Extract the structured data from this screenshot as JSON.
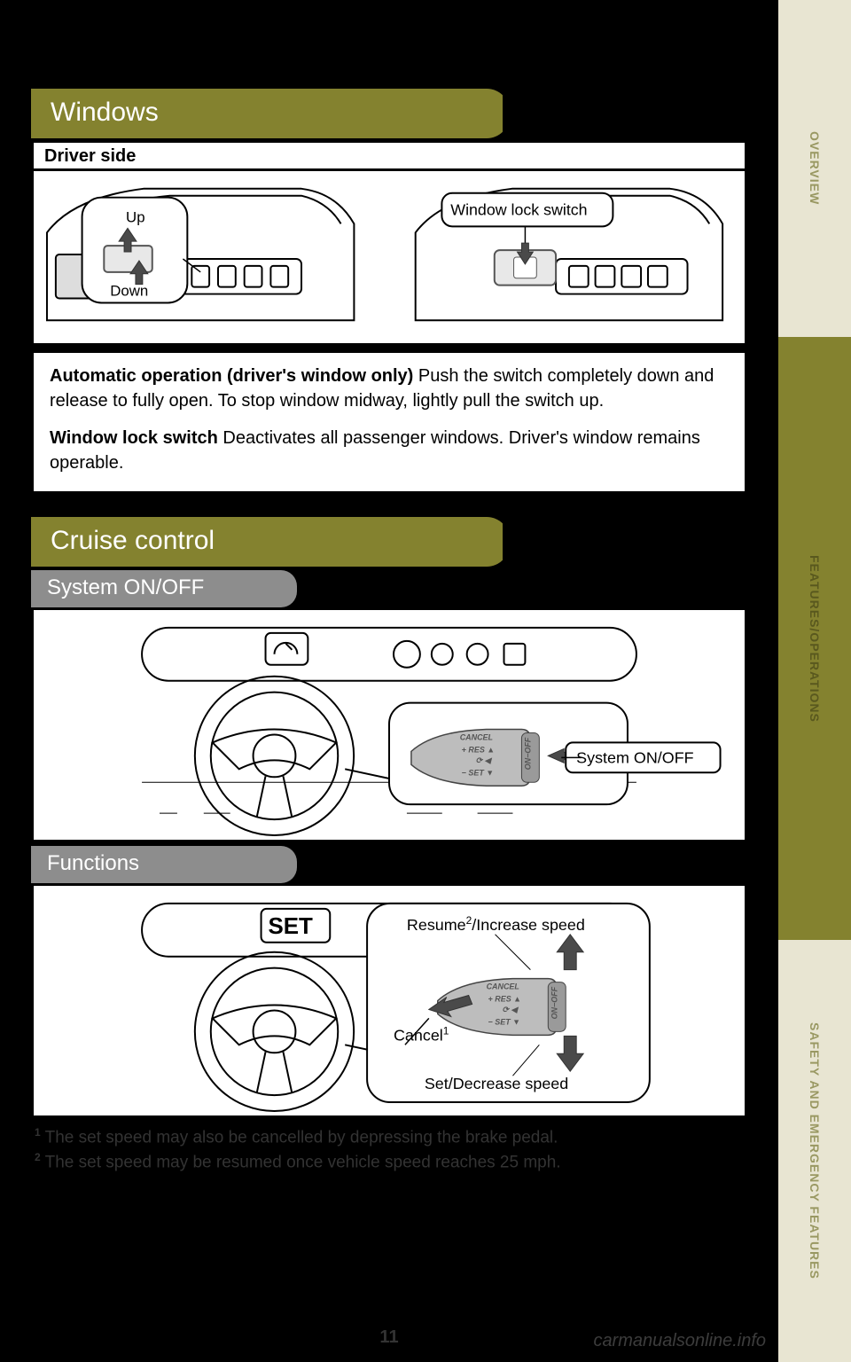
{
  "tabs": {
    "overview": "OVERVIEW",
    "features": "FEATURES/OPERATIONS",
    "safety": "SAFETY AND EMERGENCY FEATURES"
  },
  "windows": {
    "title": "Windows",
    "driver_side": "Driver side",
    "up": "Up",
    "down": "Down",
    "window_lock": "Window lock switch",
    "auto_op_bold": "Automatic operation (driver's window only) ",
    "auto_op_text": "Push the switch completely down and release to fully open. To stop window midway, lightly pull the switch up.",
    "lock_bold": "Window lock switch ",
    "lock_text": "Deactivates all passenger windows. Driver's window remains operable."
  },
  "cruise": {
    "title": "Cruise control",
    "system_onoff": "System ON/OFF",
    "system_label": "System ON/OFF",
    "functions": "Functions",
    "set": "SET",
    "resume": "Resume",
    "resume_sup": "2",
    "resume_rest": "/Increase speed",
    "cancel": "Cancel",
    "cancel_sup": "1",
    "set_decrease": "Set/Decrease speed",
    "lever_cancel": "CANCEL",
    "lever_res": "+ RES",
    "lever_set": "− SET",
    "lever_onoff": "ON−OFF"
  },
  "footnotes": {
    "f1_sup": "1",
    "f1": " The set speed may also be cancelled by depressing the brake pedal.",
    "f2_sup": "2",
    "f2": " The set speed may be resumed once vehicle speed reaches 25 mph."
  },
  "page_number": "11",
  "watermark": "carmanualsonline.info"
}
